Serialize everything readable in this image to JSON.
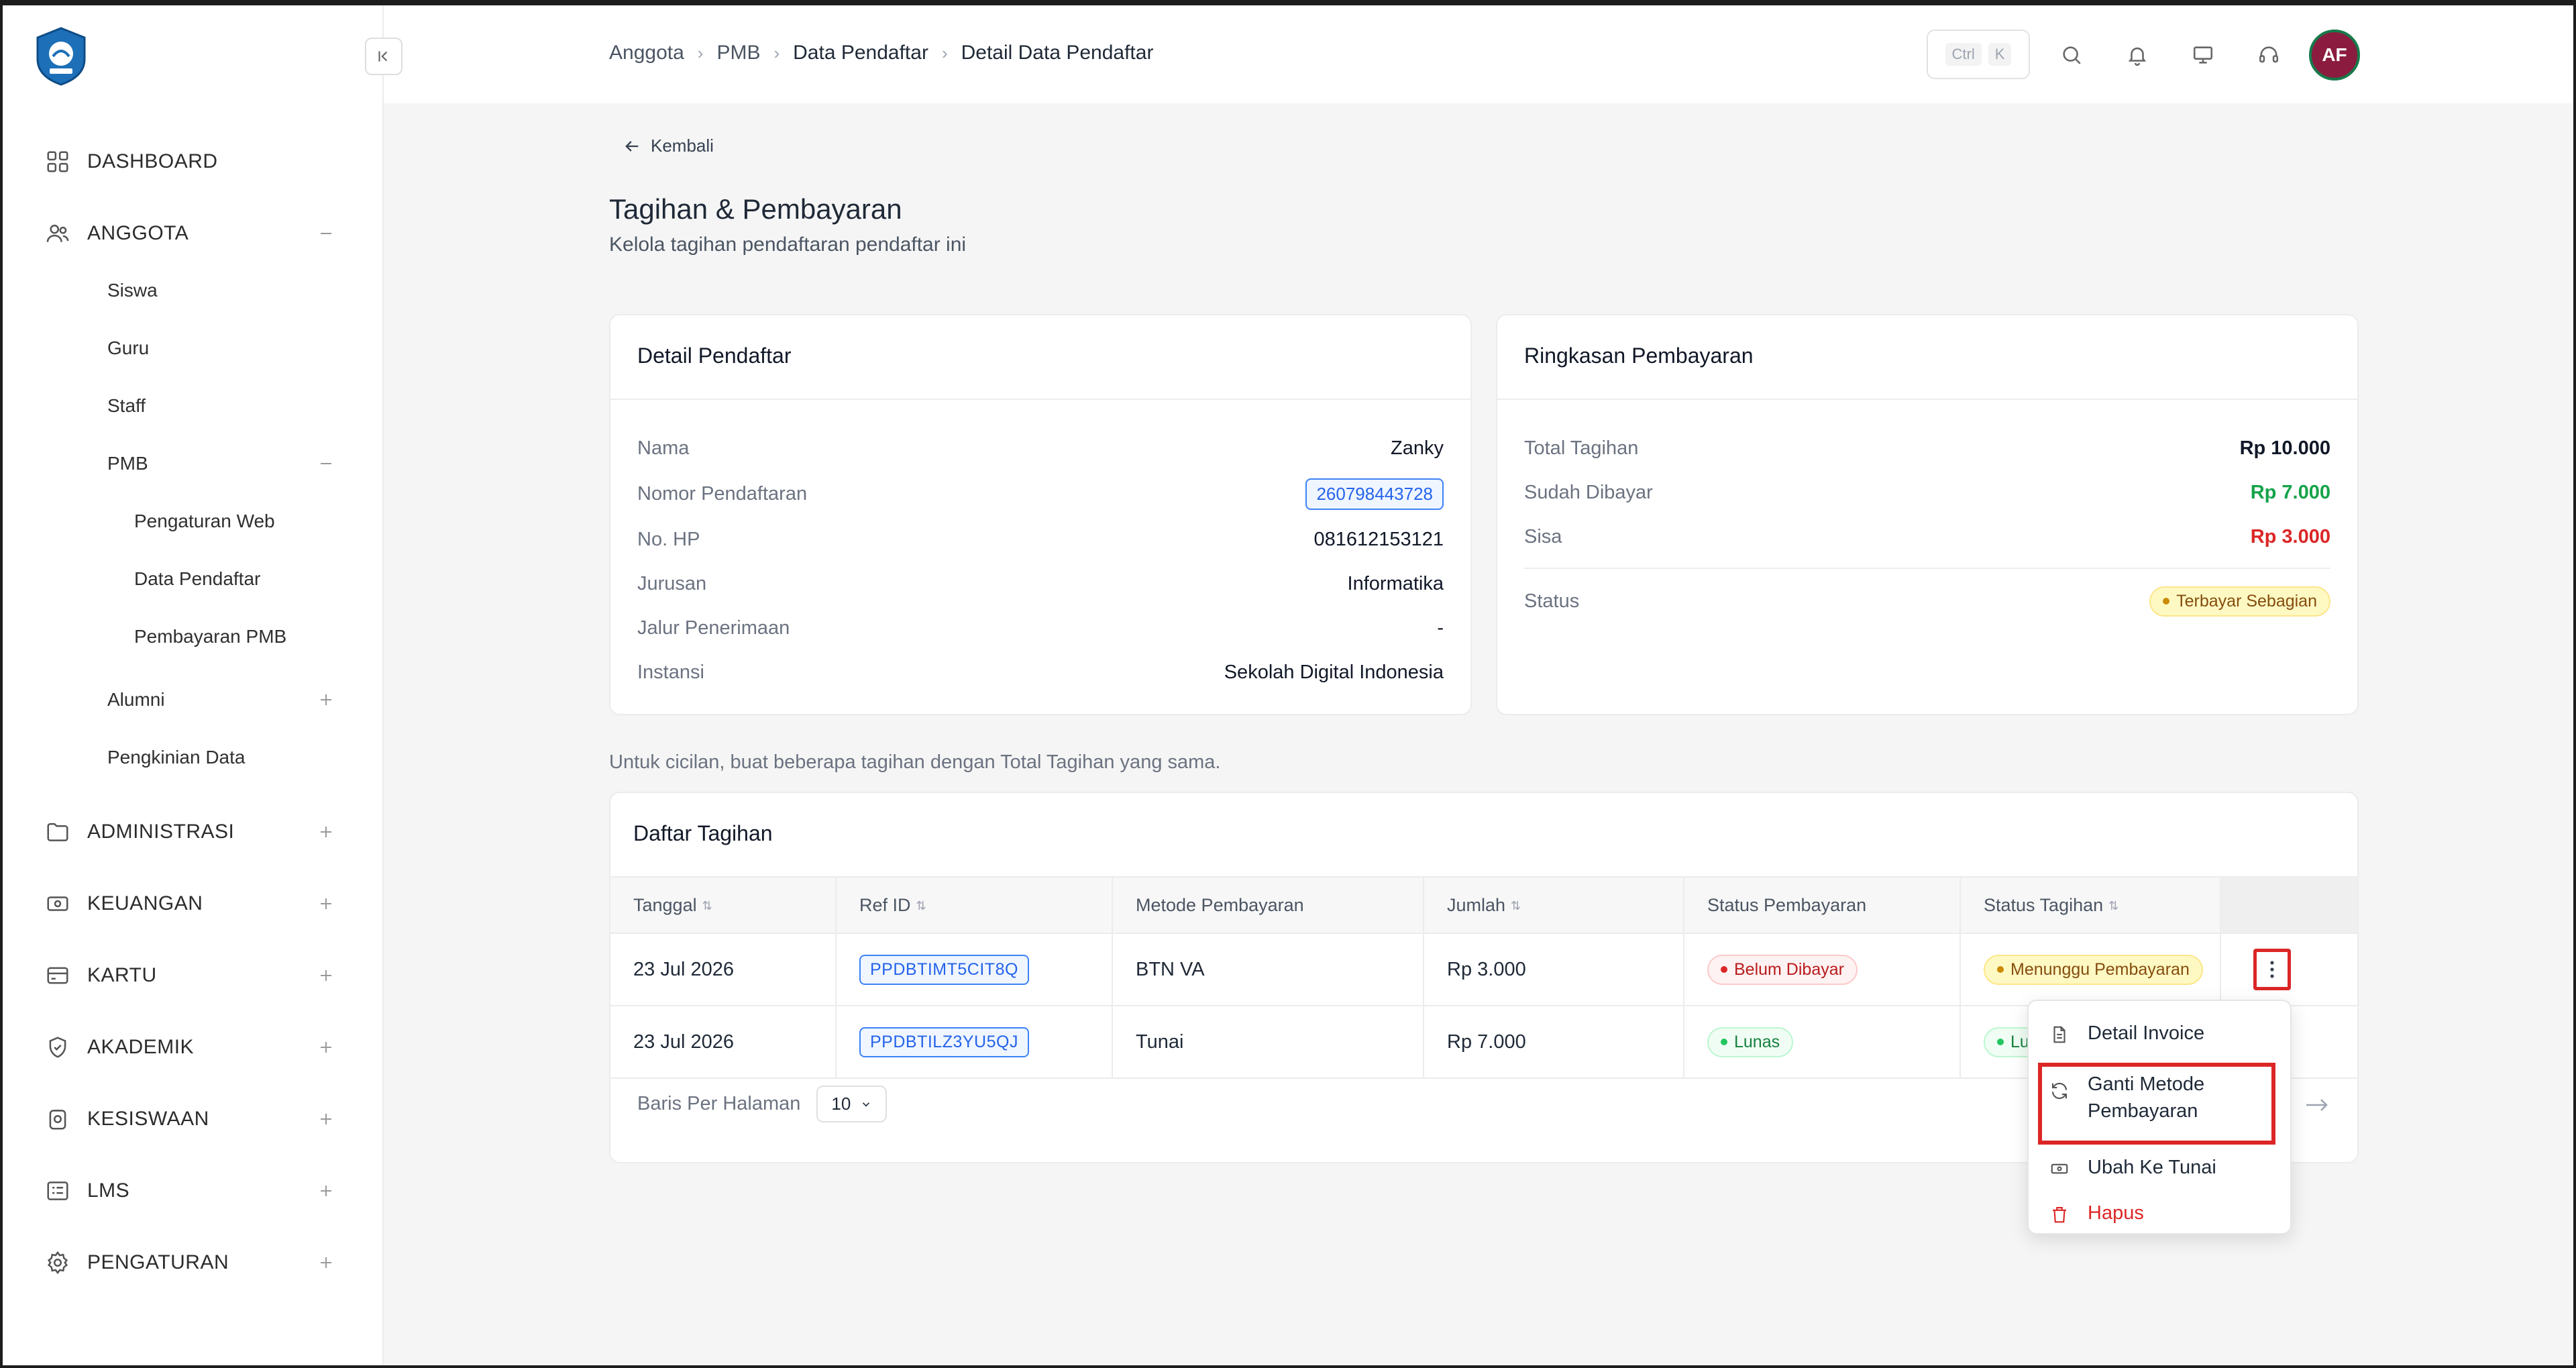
{
  "sidebar": {
    "nav": [
      {
        "label": "DASHBOARD",
        "icon": "grid-icon",
        "toggle": ""
      },
      {
        "label": "ANGGOTA",
        "icon": "users-icon",
        "toggle": "minus"
      },
      {
        "label": "ADMINISTRASI",
        "icon": "folder-icon",
        "toggle": "plus"
      },
      {
        "label": "KEUANGAN",
        "icon": "money-icon",
        "toggle": "plus"
      },
      {
        "label": "KARTU",
        "icon": "card-icon",
        "toggle": "plus"
      },
      {
        "label": "AKADEMIK",
        "icon": "shield-icon",
        "toggle": "plus"
      },
      {
        "label": "KESISWAAN",
        "icon": "badge-icon",
        "toggle": "plus"
      },
      {
        "label": "LMS",
        "icon": "list-icon",
        "toggle": "plus"
      },
      {
        "label": "PENGATURAN",
        "icon": "gear-icon",
        "toggle": "plus"
      }
    ],
    "anggota_sub": [
      "Siswa",
      "Guru",
      "Staff",
      "PMB",
      "Alumni",
      "Pengkinian Data"
    ],
    "pmb_sub": [
      "Pengaturan Web",
      "Data Pendaftar",
      "Pembayaran PMB"
    ]
  },
  "breadcrumb": [
    "Anggota",
    "PMB",
    "Data Pendaftar",
    "Detail Data Pendaftar"
  ],
  "shortcut": {
    "key1": "Ctrl",
    "key2": "K"
  },
  "user": {
    "initials": "AF"
  },
  "back_label": "Kembali",
  "page": {
    "title": "Tagihan & Pembayaran",
    "subtitle": "Kelola tagihan pendaftaran pendaftar ini"
  },
  "detail": {
    "title": "Detail Pendaftar",
    "rows": [
      {
        "label": "Nama",
        "value": "Zanky"
      },
      {
        "label": "Nomor Pendaftaran",
        "value": "260798443728"
      },
      {
        "label": "No. HP",
        "value": "081612153121"
      },
      {
        "label": "Jurusan",
        "value": "Informatika"
      },
      {
        "label": "Jalur Penerimaan",
        "value": "-"
      },
      {
        "label": "Instansi",
        "value": "Sekolah Digital Indonesia"
      }
    ]
  },
  "summary": {
    "title": "Ringkasan Pembayaran",
    "total_label": "Total Tagihan",
    "total": "Rp 10.000",
    "paid_label": "Sudah Dibayar",
    "paid": "Rp 7.000",
    "rest_label": "Sisa",
    "rest": "Rp 3.000",
    "status_label": "Status",
    "status": "Terbayar Sebagian"
  },
  "note": "Untuk cicilan, buat beberapa tagihan dengan Total Tagihan yang sama.",
  "invoices": {
    "title": "Daftar Tagihan",
    "columns": [
      "Tanggal",
      "Ref ID",
      "Metode Pembayaran",
      "Jumlah",
      "Status Pembayaran",
      "Status Tagihan"
    ],
    "rows": [
      {
        "date": "23 Jul 2026",
        "ref": "PPDBTIMT5CIT8Q",
        "method": "BTN VA",
        "amount": "Rp 3.000",
        "pay_status": "Belum Dibayar",
        "bill_status": "Menunggu Pembayaran"
      },
      {
        "date": "23 Jul 2026",
        "ref": "PPDBTILZ3YU5QJ",
        "method": "Tunai",
        "amount": "Rp 7.000",
        "pay_status": "Lunas",
        "bill_status": "Lunas"
      }
    ],
    "per_page_label": "Baris Per Halaman",
    "per_page_value": "10"
  },
  "context_menu": {
    "items": [
      "Detail Invoice",
      "Ganti Metode Pembayaran",
      "Ubah Ke Tunai",
      "Hapus"
    ]
  },
  "colors": {
    "accent": "#2563eb",
    "danger": "#dc2626",
    "success": "#16a34a",
    "highlight": "#dc2626"
  }
}
